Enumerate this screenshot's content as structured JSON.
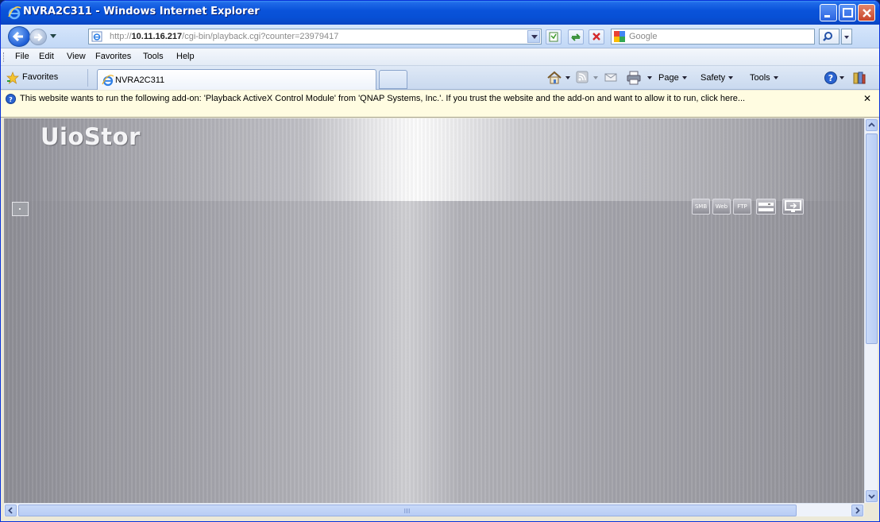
{
  "window": {
    "title": "NVRA2C311 - Windows Internet Explorer"
  },
  "address": {
    "url_prefix": "http://",
    "url_host": "10.11.16.217",
    "url_path": "/cgi-bin/playback.cgi?counter=23979417"
  },
  "search": {
    "placeholder": "Google"
  },
  "menu": {
    "items": [
      "File",
      "Edit",
      "View",
      "Favorites",
      "Tools",
      "Help"
    ]
  },
  "tabbar": {
    "favorites_label": "Favorites",
    "tab_label": "NVRA2C311",
    "commands": {
      "page": "Page",
      "safety": "Safety",
      "tools": "Tools"
    }
  },
  "infobar": {
    "message": "This website wants to run the following add-on: 'Playback ActiveX Control Module' from 'QNAP Systems, Inc.'. If you trust the website and the add-on and want to allow it to run, click here...",
    "close_glyph": "✕"
  },
  "page": {
    "brand": "UioStor",
    "services": [
      "SMB",
      "Web",
      "FTP"
    ]
  },
  "colors": {
    "titlebar": "#0a53da",
    "infobar_bg": "#fffce1",
    "content_gray": "#a6a6ad"
  }
}
